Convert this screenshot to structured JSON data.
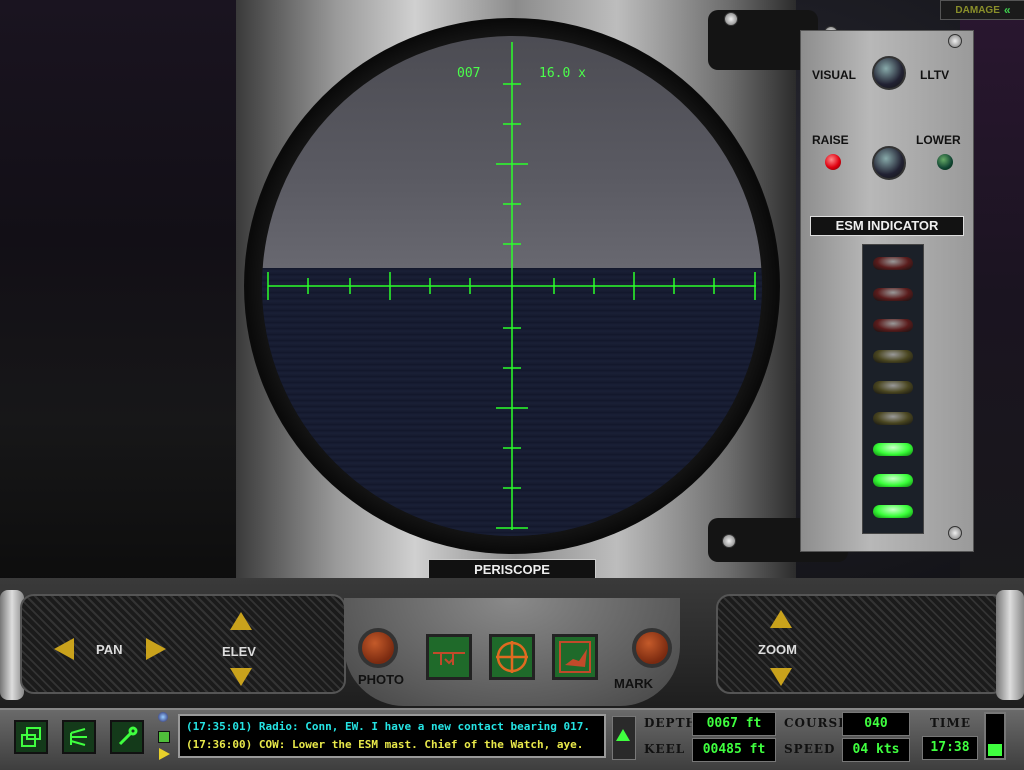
{
  "damage_tab": {
    "label": "DAMAGE"
  },
  "periscope": {
    "bearing": "007",
    "zoom": "16.0 x",
    "label": "PERISCOPE"
  },
  "control_panel": {
    "visual_label": "VISUAL",
    "lltv_label": "LLTV",
    "raise_label": "RAISE",
    "lower_label": "LOWER",
    "esm_label": "ESM INDICATOR",
    "esm_leds": [
      {
        "color": "#5a1c1c"
      },
      {
        "color": "#5a1c1c"
      },
      {
        "color": "#5a1c1c"
      },
      {
        "color": "#4a4620"
      },
      {
        "color": "#4a4620"
      },
      {
        "color": "#4a4620"
      },
      {
        "color": "#3aff3a"
      },
      {
        "color": "#3aff3a"
      },
      {
        "color": "#3aff3a"
      }
    ]
  },
  "controls": {
    "pan_label": "PAN",
    "elev_label": "ELEV",
    "photo_label": "PHOTO",
    "mark_label": "MARK",
    "zoom_label": "ZOOM"
  },
  "messages": [
    "(17:35:01) Radio: Conn, EW. I have a new contact bearing 017.",
    "(17:36:00) COW: Lower the ESM mast.  Chief of the Watch, aye."
  ],
  "readouts": {
    "depth_label": "DEPTH",
    "depth_value": "0067 ft",
    "keel_label": "KEEL",
    "keel_value": "00485 ft",
    "course_label": "COURSE",
    "course_value": "040",
    "speed_label": "SPEED",
    "speed_value": "04 kts",
    "time_label": "TIME",
    "time_value": "17:38"
  },
  "colors": {
    "reticle": "#2bff2b",
    "message_radio": "#25e3e3",
    "message_cow": "#e8e84a"
  }
}
